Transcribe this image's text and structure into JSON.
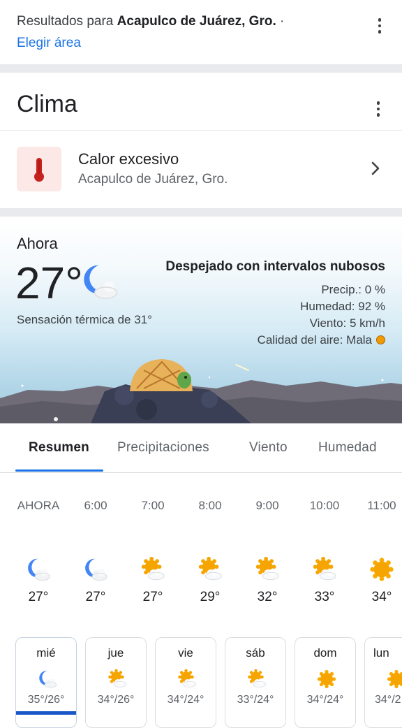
{
  "results": {
    "prefix": "Resultados para ",
    "location": "Acapulco de Juárez, Gro.",
    "suffix": " ·",
    "choose_area": "Elegir área"
  },
  "clima": {
    "title": "Clima"
  },
  "alert": {
    "title": "Calor excesivo",
    "subtitle": "Acapulco de Juárez, Gro.",
    "icon": "thermometer-icon"
  },
  "now": {
    "label": "Ahora",
    "temp": "27°",
    "feels_like": "Sensación térmica de 31°",
    "condition": "Despejado con intervalos nubosos",
    "precip": "Precip.: 0 %",
    "humidity": "Humedad: 92 %",
    "wind": "Viento: 5 km/h",
    "air_quality": "Calidad del aire: Mala",
    "air_quality_color": "#f29900",
    "icon": "moon-cloud-icon"
  },
  "tabs": [
    "Resumen",
    "Precipitaciones",
    "Viento",
    "Humedad"
  ],
  "hourly": [
    {
      "time": "AHORA",
      "temp": "27°",
      "icon": "moon-cloud"
    },
    {
      "time": "6:00",
      "temp": "27°",
      "icon": "moon-cloud"
    },
    {
      "time": "7:00",
      "temp": "27°",
      "icon": "sun-cloud"
    },
    {
      "time": "8:00",
      "temp": "29°",
      "icon": "sun-cloud"
    },
    {
      "time": "9:00",
      "temp": "32°",
      "icon": "sun-cloud"
    },
    {
      "time": "10:00",
      "temp": "33°",
      "icon": "sun-cloud"
    },
    {
      "time": "11:00",
      "temp": "34°",
      "icon": "sun"
    }
  ],
  "daily": [
    {
      "day": "mié",
      "range": "35°/26°",
      "icon": "moon-cloud"
    },
    {
      "day": "jue",
      "range": "34°/26°",
      "icon": "sun-cloud"
    },
    {
      "day": "vie",
      "range": "34°/24°",
      "icon": "sun-cloud"
    },
    {
      "day": "sáb",
      "range": "33°/24°",
      "icon": "sun-cloud"
    },
    {
      "day": "dom",
      "range": "34°/24°",
      "icon": "sun"
    },
    {
      "day": "lun",
      "range": "34°/2",
      "icon": "sun"
    }
  ],
  "colors": {
    "accent": "#1a73e8",
    "alert_bg": "#fce8e6",
    "sun": "#f29900"
  }
}
